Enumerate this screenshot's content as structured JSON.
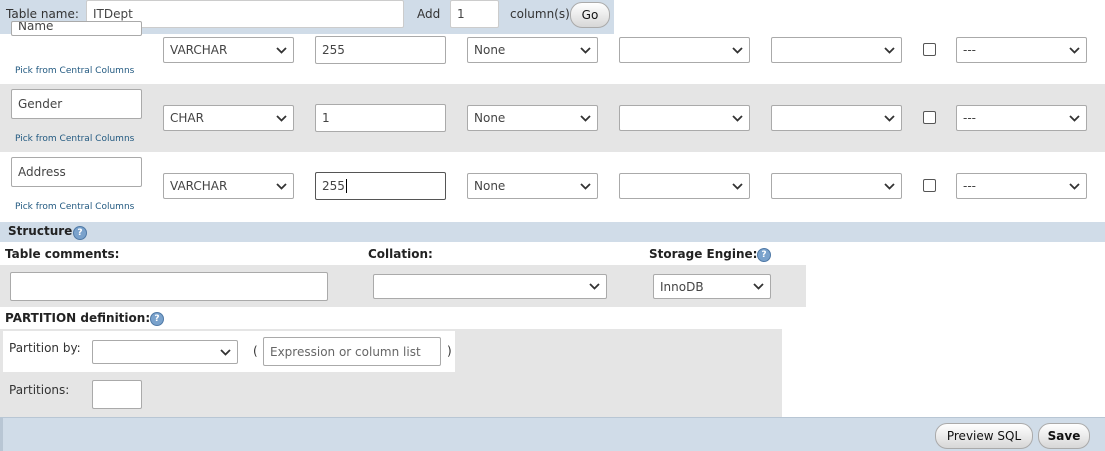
{
  "header": {
    "table_name_label": "Table name:",
    "table_name_value": "ITDept",
    "add_label": "Add",
    "add_value": "1",
    "columns_label": "column(s)",
    "go_label": "Go"
  },
  "columns": [
    {
      "name": "Name",
      "type": "VARCHAR",
      "length": "255",
      "default": "None",
      "collation": "",
      "attributes": "",
      "null_checked": false,
      "index": "---",
      "pick_link": "Pick from Central Columns"
    },
    {
      "name": "Gender",
      "type": "CHAR",
      "length": "1",
      "default": "None",
      "collation": "",
      "attributes": "",
      "null_checked": false,
      "index": "---",
      "pick_link": "Pick from Central Columns"
    },
    {
      "name": "Address",
      "type": "VARCHAR",
      "length": "255",
      "default": "None",
      "collation": "",
      "attributes": "",
      "null_checked": false,
      "index": "---",
      "pick_link": "Pick from Central Columns"
    }
  ],
  "structure": {
    "title": "Structure",
    "table_comments_label": "Table comments:",
    "collation_label": "Collation:",
    "storage_engine_label": "Storage Engine:",
    "storage_engine_value": "InnoDB",
    "collation_value": "",
    "table_comments_value": ""
  },
  "partition": {
    "title": "PARTITION definition:",
    "partition_by_label": "Partition by:",
    "partition_by_value": "",
    "open_paren": "(",
    "close_paren": ")",
    "expression_placeholder": "Expression or column list",
    "partitions_label": "Partitions:",
    "partitions_value": ""
  },
  "footer": {
    "preview_sql_label": "Preview SQL",
    "save_label": "Save"
  },
  "colors": {
    "header_bg": "#d0dce8",
    "row_alt_bg": "#e5e5e5",
    "section_bar_bg": "#d0dce8",
    "link": "#235a81"
  }
}
